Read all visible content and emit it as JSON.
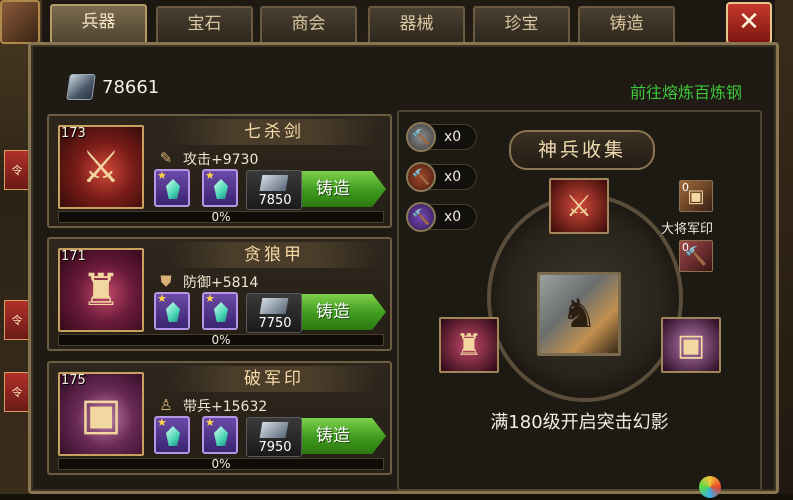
{
  "tabs": [
    {
      "label": "兵器",
      "active": true
    },
    {
      "label": "宝石",
      "active": false
    },
    {
      "label": "商会",
      "active": false
    },
    {
      "label": "器械",
      "active": false
    },
    {
      "label": "珍宝",
      "active": false
    },
    {
      "label": "铸造",
      "active": false
    }
  ],
  "close_label": "✕",
  "currency": {
    "icon": "steel-ingot-icon",
    "amount": "78661"
  },
  "goto_link": "前往熔炼百炼钢",
  "items": [
    {
      "level": "173",
      "name": "七杀剑",
      "stat_icon": "sword-icon",
      "stat": "攻击+9730",
      "gems": 2,
      "cost": "7850",
      "forge_label": "铸造",
      "progress": 0,
      "progress_label": "0%"
    },
    {
      "level": "171",
      "name": "贪狼甲",
      "stat_icon": "shield-icon",
      "stat": "防御+5814",
      "gems": 2,
      "cost": "7750",
      "forge_label": "铸造",
      "progress": 0,
      "progress_label": "0%"
    },
    {
      "level": "175",
      "name": "破军印",
      "stat_icon": "general-icon",
      "stat": "带兵+15632",
      "gems": 2,
      "cost": "7950",
      "forge_label": "铸造",
      "progress": 0,
      "progress_label": "0%"
    }
  ],
  "hammers": [
    {
      "icon": "iron-hammer-icon",
      "count": "x0"
    },
    {
      "icon": "bronze-hammer-icon",
      "count": "x0"
    },
    {
      "icon": "purple-hammer-icon",
      "count": "x0"
    }
  ],
  "collection": {
    "title": "神兵收集",
    "mini_items": [
      {
        "num": "0",
        "label": "大将军印"
      },
      {
        "num": "0",
        "label": ""
      }
    ],
    "unlock_text": "满180级开启突击幻影"
  },
  "colors": {
    "accent_green": "#3ec63a",
    "tab_active": "#7a6a4e",
    "close_red": "#c6382c"
  }
}
